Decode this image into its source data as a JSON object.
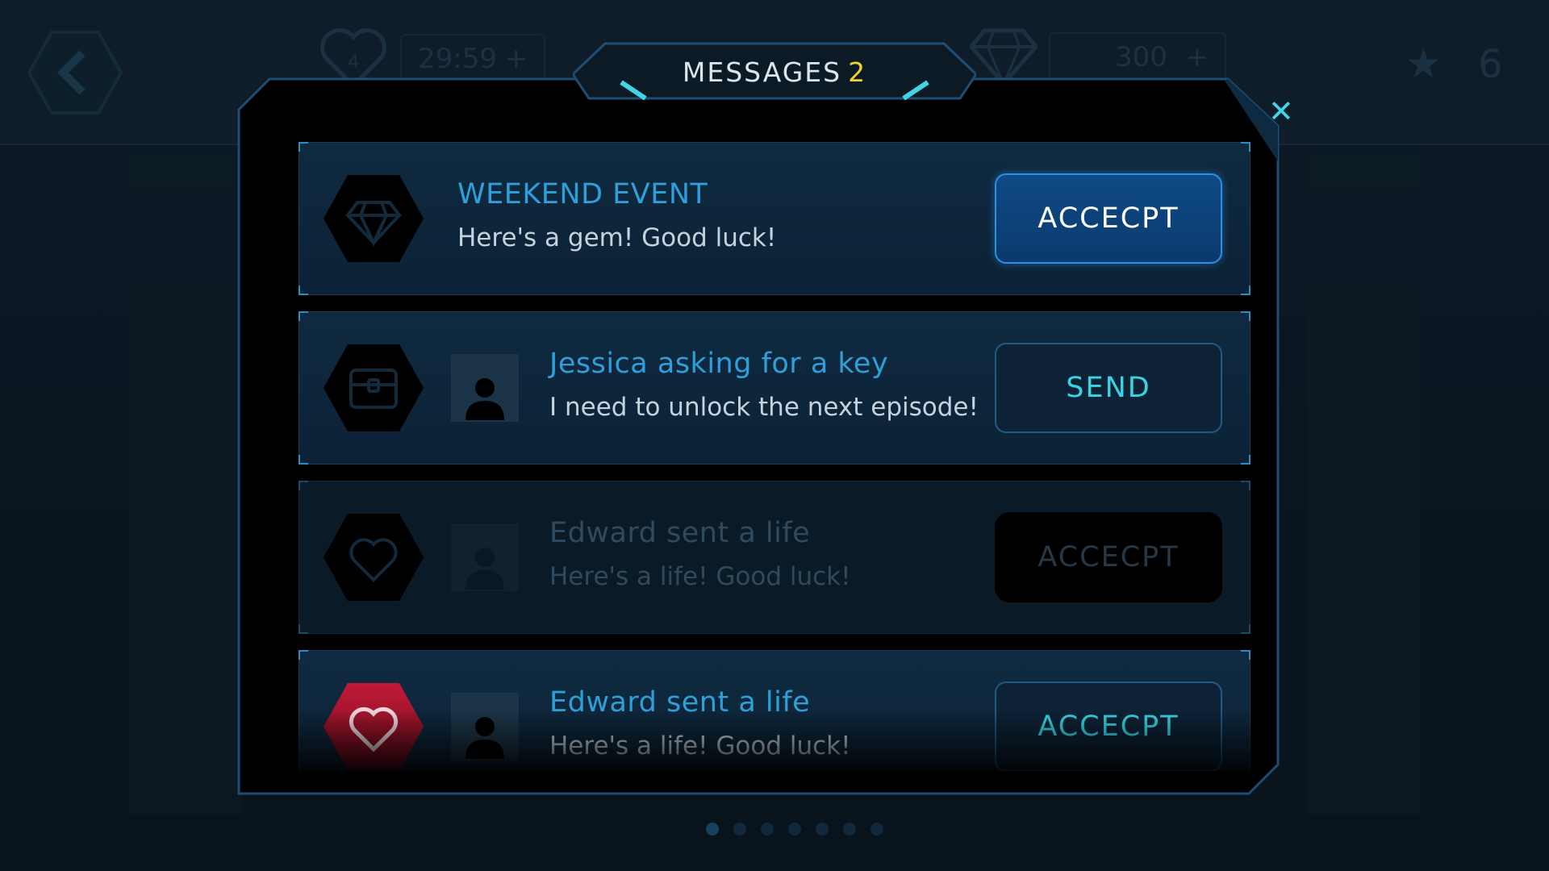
{
  "hud": {
    "lives_count": "4",
    "lives_timer": "29:59",
    "gems_count": "300",
    "stars_count": "6",
    "plus": "+"
  },
  "modal": {
    "title": "MESSAGES",
    "unread_count": "2",
    "close_glyph": "✕"
  },
  "messages": [
    {
      "icon": "gem-icon",
      "title": "WEEKEND EVENT",
      "body": "Here's a gem! Good luck!",
      "action": "ACCECPT",
      "has_avatar": false,
      "state": "primary"
    },
    {
      "icon": "chest-icon",
      "title": "Jessica asking for a key",
      "body": "I need to unlock the next episode!",
      "action": "SEND",
      "has_avatar": true,
      "state": "outline"
    },
    {
      "icon": "heart-icon",
      "title": "Edward sent a life",
      "body": "Here's a life! Good luck!",
      "action": "ACCECPT",
      "has_avatar": true,
      "state": "disabled"
    },
    {
      "icon": "heart-red-icon",
      "title": "Edward sent a life",
      "body": "Here's a life! Good luck!",
      "action": "ACCECPT",
      "has_avatar": true,
      "state": "outline"
    }
  ],
  "colors": {
    "accent": "#2d9fd9",
    "cyan": "#35d5e4",
    "highlight": "#f2d427",
    "modal_bg": "#000000",
    "heart_red": "#a3122a"
  }
}
